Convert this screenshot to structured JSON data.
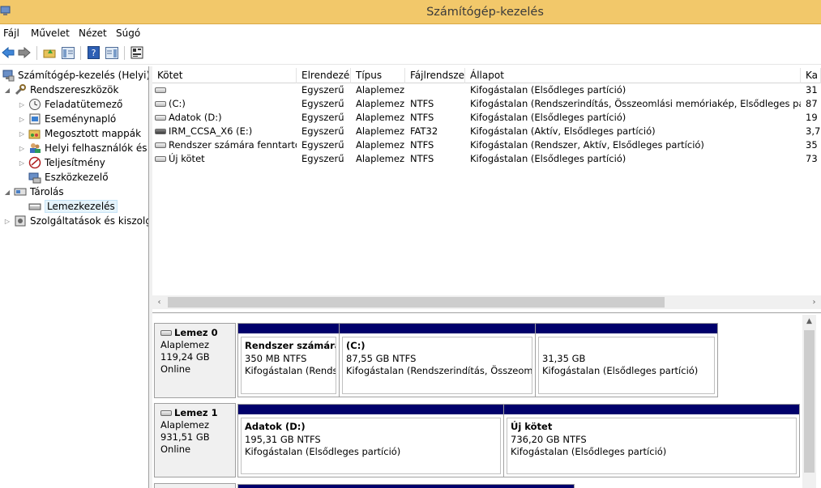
{
  "window": {
    "title": "Számítógép-kezelés"
  },
  "menu": [
    "Fájl",
    "Művelet",
    "Nézet",
    "Súgó"
  ],
  "tree": {
    "root": "Számítógép-kezelés (Helyi)",
    "system_tools": "Rendszereszközök",
    "task_scheduler": "Feladatütemező",
    "event_viewer": "Eseménynapló",
    "shared_folders": "Megosztott mappák",
    "local_users": "Helyi felhasználók és cs",
    "performance": "Teljesítmény",
    "device_manager": "Eszközkezelő",
    "storage": "Tárolás",
    "disk_management": "Lemezkezelés",
    "services": "Szolgáltatások és kiszolgáló"
  },
  "volume_list": {
    "columns": [
      "Kötet",
      "Elrendezés",
      "Típus",
      "Fájlrendszer",
      "Állapot",
      "Ka"
    ],
    "rows": [
      {
        "kotet": "",
        "elrendezes": "Egyszerű",
        "tipus": "Alaplemez",
        "fajlrendszer": "",
        "allapot": "Kifogástalan (Elsődleges partíció)",
        "kapacitas": "31"
      },
      {
        "kotet": "(C:)",
        "elrendezes": "Egyszerű",
        "tipus": "Alaplemez",
        "fajlrendszer": "NTFS",
        "allapot": "Kifogástalan (Rendszerindítás, Összeomlási memóriakép, Elsődleges partíció)",
        "kapacitas": "87"
      },
      {
        "kotet": "Adatok (D:)",
        "elrendezes": "Egyszerű",
        "tipus": "Alaplemez",
        "fajlrendszer": "NTFS",
        "allapot": "Kifogástalan (Elsődleges partíció)",
        "kapacitas": "19"
      },
      {
        "kotet": "IRM_CCSA_X6 (E:)",
        "elrendezes": "Egyszerű",
        "tipus": "Alaplemez",
        "fajlrendszer": "FAT32",
        "allapot": "Kifogástalan (Aktív, Elsődleges partíció)",
        "kapacitas": "3,7"
      },
      {
        "kotet": "Rendszer számára fenntartott",
        "elrendezes": "Egyszerű",
        "tipus": "Alaplemez",
        "fajlrendszer": "NTFS",
        "allapot": "Kifogástalan (Rendszer, Aktív, Elsődleges partíció)",
        "kapacitas": "35"
      },
      {
        "kotet": "Új kötet",
        "elrendezes": "Egyszerű",
        "tipus": "Alaplemez",
        "fajlrendszer": "NTFS",
        "allapot": "Kifogástalan (Elsődleges partíció)",
        "kapacitas": "73"
      }
    ]
  },
  "disks": [
    {
      "name": "Lemez 0",
      "type": "Alaplemez",
      "size": "119,24 GB",
      "status": "Online",
      "partitions": [
        {
          "name": "Rendszer számára f",
          "size": "350 MB NTFS",
          "status": "Kifogástalan (Rendsz"
        },
        {
          "name": "(C:)",
          "size": "87,55 GB NTFS",
          "status": "Kifogástalan (Rendszerindítás, Összeomlási"
        },
        {
          "name": "",
          "size": "31,35 GB",
          "status": "Kifogástalan (Elsődleges partíció)"
        }
      ]
    },
    {
      "name": "Lemez 1",
      "type": "Alaplemez",
      "size": "931,51 GB",
      "status": "Online",
      "partitions": [
        {
          "name": "Adatok  (D:)",
          "size": "195,31 GB NTFS",
          "status": "Kifogástalan (Elsődleges partíció)"
        },
        {
          "name": "Új kötet",
          "size": "736,20 GB NTFS",
          "status": "Kifogástalan (Elsődleges partíció)"
        }
      ]
    }
  ],
  "colors": {
    "titlebar": "#f2c86a",
    "partition_bar": "#00006b",
    "selection": "#e5f3fb"
  },
  "icons": [
    "computer-management-icon",
    "back-arrow-icon",
    "forward-arrow-icon",
    "up-folder-icon",
    "show-hide-tree-icon",
    "help-icon",
    "properties-icon",
    "disk-icon"
  ]
}
